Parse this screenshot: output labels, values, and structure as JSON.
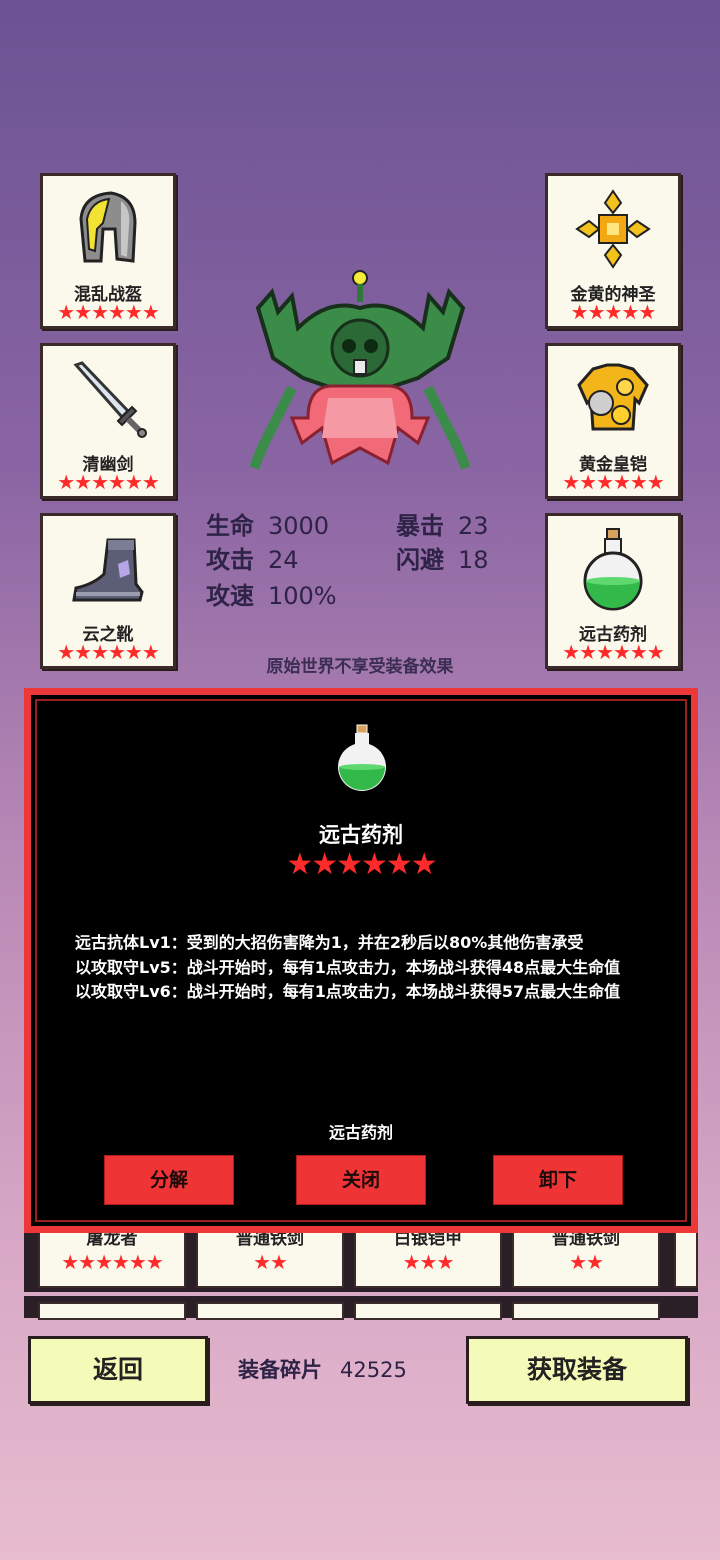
{
  "equip_left": [
    {
      "name": "混乱战盔",
      "stars": "★★★★★★",
      "icon": "helmet-icon"
    },
    {
      "name": "清幽剑",
      "stars": "★★★★★★",
      "icon": "sword-icon"
    },
    {
      "name": "云之靴",
      "stars": "★★★★★★",
      "icon": "boots-icon"
    }
  ],
  "equip_right": [
    {
      "name": "金黄的神圣",
      "stars": "★★★★★",
      "icon": "holy-cross-icon"
    },
    {
      "name": "黄金皇铠",
      "stars": "★★★★★★",
      "icon": "gold-armor-icon"
    },
    {
      "name": "远古药剂",
      "stars": "★★★★★★",
      "icon": "potion-icon"
    }
  ],
  "stats": {
    "hp_label": "生命",
    "hp": "3000",
    "crit_label": "暴击",
    "crit": "23",
    "atk_label": "攻击",
    "atk": "24",
    "dodge_label": "闪避",
    "dodge": "18",
    "aspd_label": "攻速",
    "aspd": "100%"
  },
  "note": "原始世界不享受装备效果",
  "inventory": [
    {
      "name": "屠龙者",
      "stars": "★★★★★★"
    },
    {
      "name": "普通铁剑",
      "stars": "★★"
    },
    {
      "name": "白银铠甲",
      "stars": "★★★"
    },
    {
      "name": "普通铁剑",
      "stars": "★★"
    }
  ],
  "dialog": {
    "item_name": "远古药剂",
    "stars": "★★★★★★",
    "desc": [
      "远古抗体Lv1：受到的大招伤害降为1，并在2秒后以80%其他伤害承受",
      "以攻取守Lv5：战斗开始时，每有1点攻击力，本场战斗获得48点最大生命值",
      "以攻取守Lv6：战斗开始时，每有1点攻击力，本场战斗获得57点最大生命值"
    ],
    "footer": "远古药剂",
    "btn_decompose": "分解",
    "btn_close": "关闭",
    "btn_unequip": "卸下"
  },
  "bottom": {
    "back": "返回",
    "fragments_label": "装备碎片",
    "fragments_value": "42525",
    "get_equip": "获取装备"
  },
  "colors": {
    "accent_red": "#ec3838",
    "star": "#ff2a2a",
    "button_yellow": "#f4fab8"
  }
}
